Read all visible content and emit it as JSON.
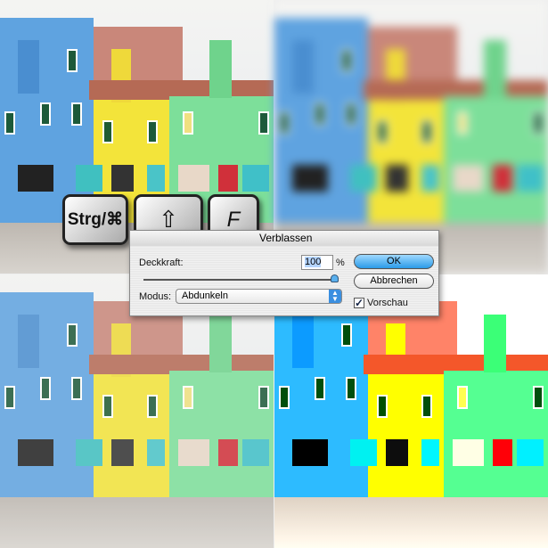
{
  "keys": {
    "ctrl": "Strg/⌘",
    "shift": "⇧",
    "f": "F"
  },
  "dialog": {
    "title": "Verblassen",
    "opacity_label": "Deckkraft:",
    "opacity_value": "100",
    "opacity_unit": "%",
    "opacity_slider_percent": 100,
    "mode_label": "Modus:",
    "mode_value": "Abdunkeln",
    "ok": "OK",
    "cancel": "Abbrechen",
    "preview_label": "Vorschau",
    "preview_checked": true
  },
  "colors": {
    "accent": "#3aa0e8"
  }
}
